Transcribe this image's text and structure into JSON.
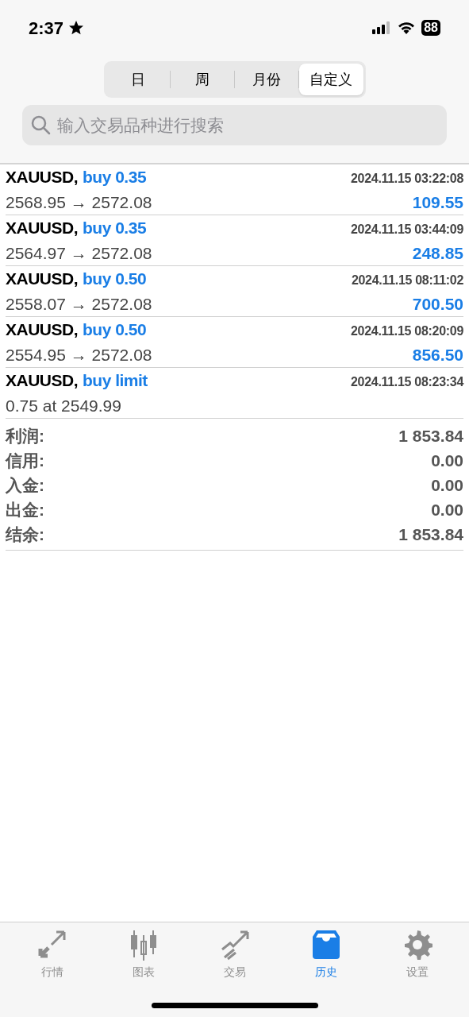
{
  "status_bar": {
    "time": "2:37",
    "battery": "88"
  },
  "segments": [
    {
      "label": "日",
      "selected": false
    },
    {
      "label": "周",
      "selected": false
    },
    {
      "label": "月份",
      "selected": false
    },
    {
      "label": "自定义",
      "selected": true
    }
  ],
  "search": {
    "placeholder": "输入交易品种进行搜索"
  },
  "trades": [
    {
      "symbol": "XAUUSD,",
      "type": "buy 0.35",
      "time": "2024.11.15 03:22:08",
      "prices": "2568.95 → 2572.08",
      "profit": "109.55"
    },
    {
      "symbol": "XAUUSD,",
      "type": "buy 0.35",
      "time": "2024.11.15 03:44:09",
      "prices": "2564.97 → 2572.08",
      "profit": "248.85"
    },
    {
      "symbol": "XAUUSD,",
      "type": "buy 0.50",
      "time": "2024.11.15 08:11:02",
      "prices": "2558.07 → 2572.08",
      "profit": "700.50"
    },
    {
      "symbol": "XAUUSD,",
      "type": "buy 0.50",
      "time": "2024.11.15 08:20:09",
      "prices": "2554.95 → 2572.08",
      "profit": "856.50"
    },
    {
      "symbol": "XAUUSD,",
      "type": "buy limit",
      "time": "2024.11.15 08:23:34",
      "prices": "0.75 at 2549.99"
    }
  ],
  "summary": [
    {
      "label": "利润:",
      "value": "1 853.84"
    },
    {
      "label": "信用:",
      "value": "0.00"
    },
    {
      "label": "入金:",
      "value": "0.00"
    },
    {
      "label": "出金:",
      "value": "0.00"
    },
    {
      "label": "结余:",
      "value": "1 853.84"
    }
  ],
  "tab_bar": [
    {
      "kind": "quotes",
      "label": "行情",
      "selected": false
    },
    {
      "kind": "chart",
      "label": "图表",
      "selected": false
    },
    {
      "kind": "trade",
      "label": "交易",
      "selected": false
    },
    {
      "kind": "history",
      "label": "历史",
      "selected": true
    },
    {
      "kind": "settings",
      "label": "设置",
      "selected": false
    }
  ]
}
